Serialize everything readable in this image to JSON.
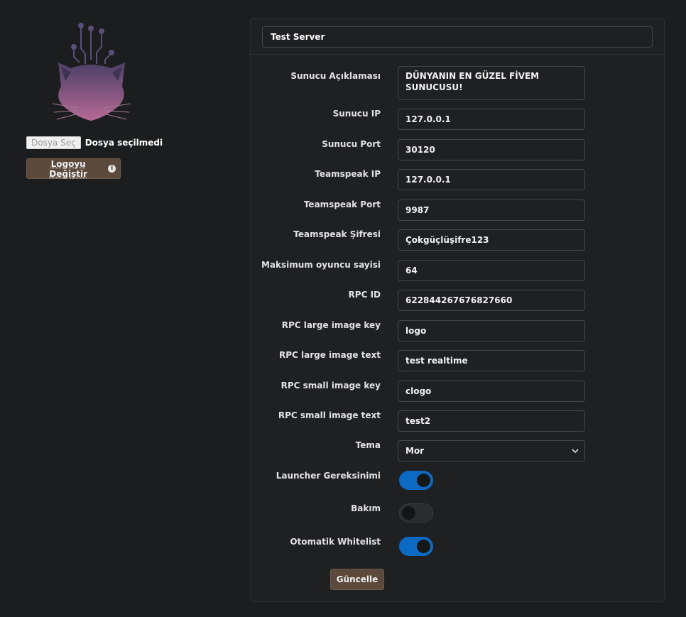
{
  "colors": {
    "background": "#1c1d1f",
    "accent_brown": "#5b4a3c",
    "toggle_on": "#0d6ac3",
    "logo_gradient_top": "#4b3f66",
    "logo_gradient_bottom": "#b56a95"
  },
  "sidebar": {
    "logo_icon": "fox-circuit-logo",
    "file_button_label": "Dosya Seç",
    "file_status": "Dosya seçilmedi",
    "change_logo_label": "Logoyu Değiştir",
    "change_logo_icon": "info-icon"
  },
  "form": {
    "server_name": "Test Server",
    "description": {
      "label": "Sunucu Açıklaması",
      "value": "DÜNYANIN EN GÜZEL FİVEM SUNUCUSU!"
    },
    "server_ip": {
      "label": "Sunucu IP",
      "value": "127.0.0.1"
    },
    "server_port": {
      "label": "Sunucu Port",
      "value": "30120"
    },
    "ts_ip": {
      "label": "Teamspeak IP",
      "value": "127.0.0.1"
    },
    "ts_port": {
      "label": "Teamspeak Port",
      "value": "9987"
    },
    "ts_password": {
      "label": "Teamspeak Şifresi",
      "value": "Çokgüçlüşifre123"
    },
    "max_players": {
      "label": "Maksimum oyuncu sayisi",
      "value": "64"
    },
    "rpc_id": {
      "label": "RPC ID",
      "value": "622844267676827660"
    },
    "rpc_large_key": {
      "label": "RPC large image key",
      "value": "logo"
    },
    "rpc_large_text": {
      "label": "RPC large image text",
      "value": "test realtime"
    },
    "rpc_small_key": {
      "label": "RPC small image key",
      "value": "clogo"
    },
    "rpc_small_text": {
      "label": "RPC small image text",
      "value": "test2"
    },
    "theme": {
      "label": "Tema",
      "value": "Mor",
      "icon": "chevron-down-icon"
    },
    "launcher_required": {
      "label": "Launcher Gereksinimi",
      "on": true
    },
    "maintenance": {
      "label": "Bakım",
      "on": false
    },
    "auto_whitelist": {
      "label": "Otomatik Whitelist",
      "on": true
    },
    "submit_label": "Güncelle"
  }
}
